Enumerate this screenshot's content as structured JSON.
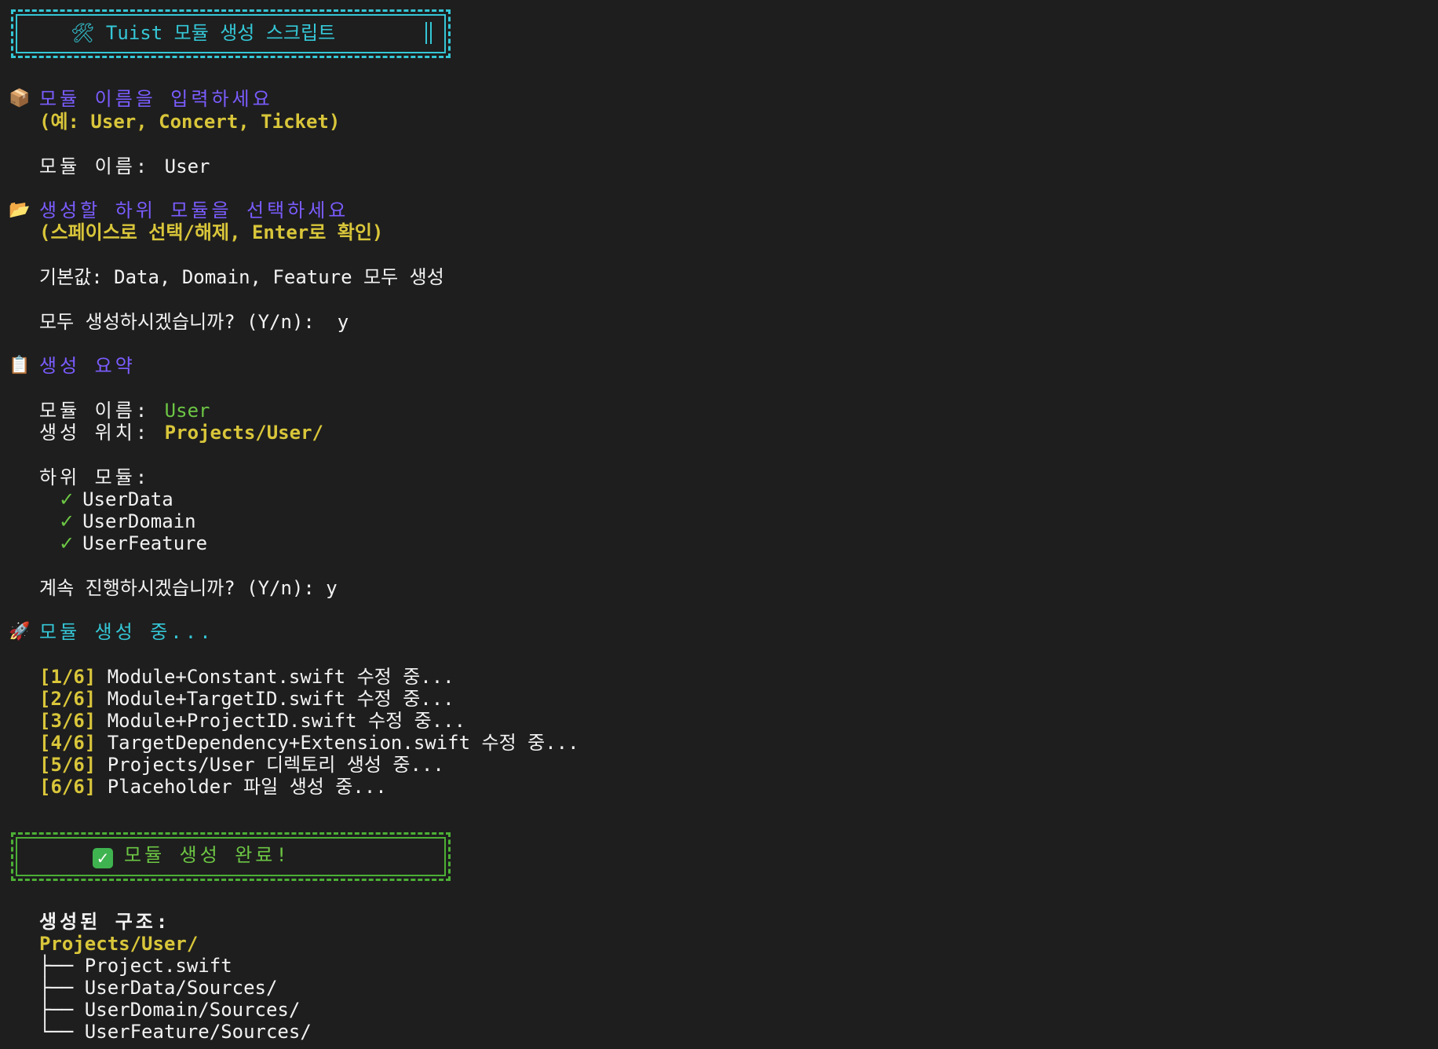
{
  "header": {
    "icon": "hammer-wrench-icon",
    "title": "🛠 Tuist 모듈 생성 스크립트"
  },
  "step_name": {
    "icon": "package-icon",
    "prompt": "모듈 이름을 입력하세요",
    "hint": "(예: User, Concert, Ticket)",
    "label": "모듈 이름: ",
    "value": "User"
  },
  "step_sub": {
    "icon": "folder-icon",
    "prompt": "생성할 하위 모듈을 선택하세요",
    "hint": "(스페이스로 선택/해제, Enter로 확인)",
    "default_text": "기본값: Data, Domain, Feature 모두 생성",
    "confirm_prompt": "모두 생성하시겠습니까? (Y/n):  ",
    "confirm_value": "y"
  },
  "summary": {
    "icon": "clipboard-icon",
    "title": "생성 요약",
    "name_label": "모듈 이름: ",
    "name_value": "User",
    "path_label": "생성 위치: ",
    "path_value": "Projects/User/",
    "sub_label": "하위 모듈:",
    "sub_items": [
      "UserData",
      "UserDomain",
      "UserFeature"
    ],
    "continue_prompt": "계속 진행하시겠습니까? (Y/n): ",
    "continue_value": "y"
  },
  "progress": {
    "icon": "rocket-icon",
    "title": "모듈 생성 중...",
    "steps": [
      {
        "tag": "[1/6]",
        "text": " Module+Constant.swift 수정 중..."
      },
      {
        "tag": "[2/6]",
        "text": " Module+TargetID.swift 수정 중..."
      },
      {
        "tag": "[3/6]",
        "text": " Module+ProjectID.swift 수정 중..."
      },
      {
        "tag": "[4/6]",
        "text": " TargetDependency+Extension.swift 수정 중..."
      },
      {
        "tag": "[5/6]",
        "text": " Projects/User 디렉토리 생성 중..."
      },
      {
        "tag": "[6/6]",
        "text": " Placeholder 파일 생성 중..."
      }
    ]
  },
  "done": {
    "icon": "check-mark-icon",
    "title": "모듈 생성 완료!"
  },
  "structure": {
    "label": "생성된 구조:",
    "root": "Projects/User/",
    "items": [
      {
        "branch": "├── ",
        "name": "Project.swift"
      },
      {
        "branch": "├── ",
        "name": "UserData/Sources/"
      },
      {
        "branch": "├── ",
        "name": "UserDomain/Sources/"
      },
      {
        "branch": "└── ",
        "name": "UserFeature/Sources/"
      }
    ]
  },
  "colors": {
    "background": "#1e1e1e",
    "purple": "#7b5cff",
    "yellow": "#d9c63a",
    "green": "#6cc644",
    "cyan": "#35c7d6"
  }
}
